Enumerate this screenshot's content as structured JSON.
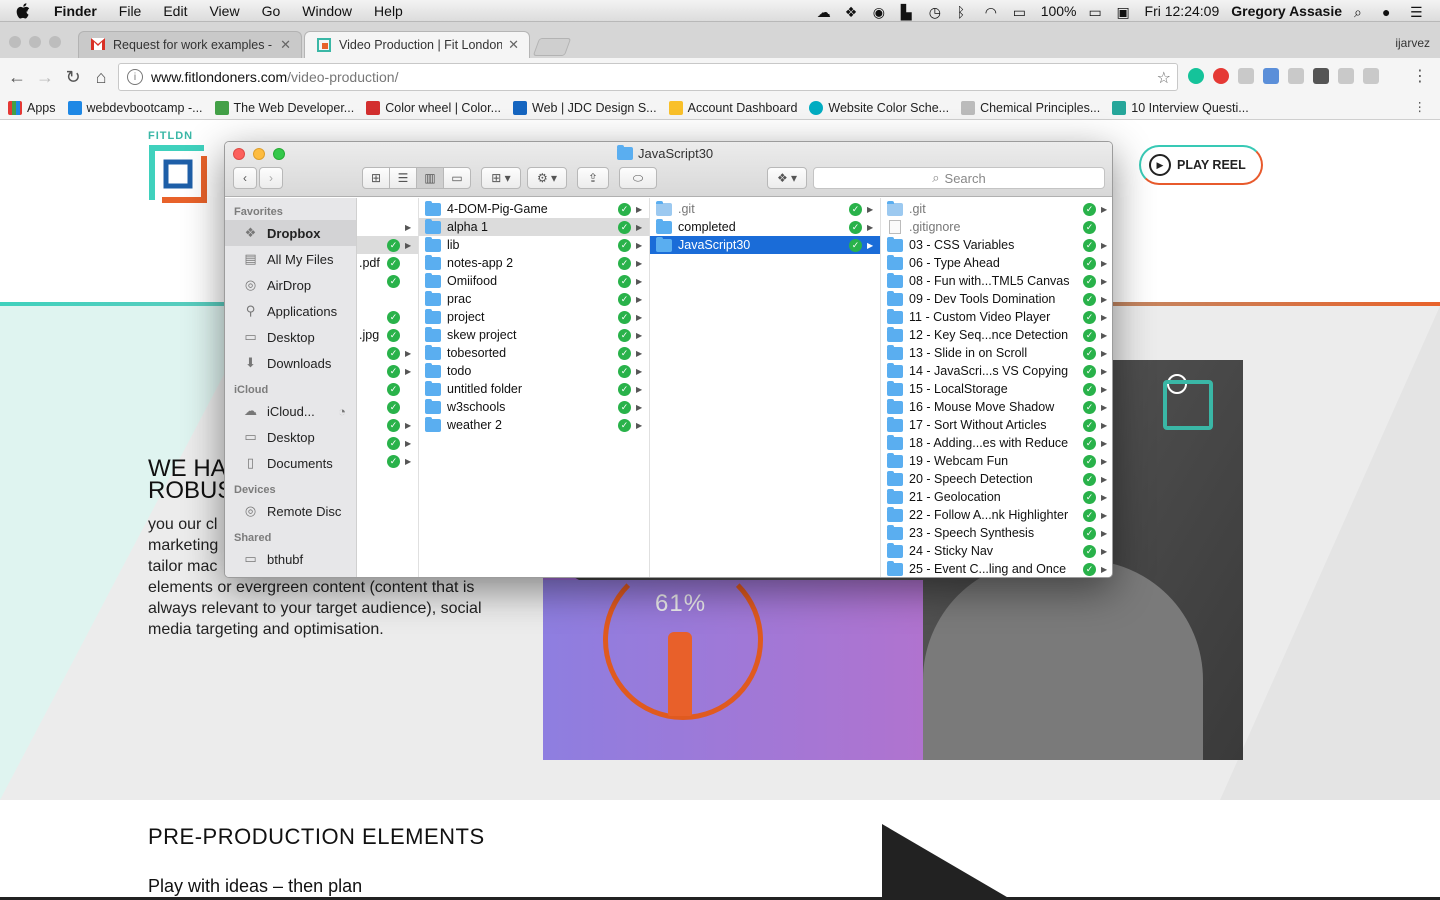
{
  "menubar": {
    "app": "Finder",
    "menus": [
      "File",
      "Edit",
      "View",
      "Go",
      "Window",
      "Help"
    ],
    "battery": "100%",
    "clock": "Fri 12:24:09",
    "user": "Gregory Assasie"
  },
  "browser": {
    "tabs": [
      {
        "title": "Request for work examples - G",
        "active": false
      },
      {
        "title": "Video Production | Fit Londone",
        "active": true
      }
    ],
    "profile": "ijarvez",
    "url_host": "www.fitlondoners.com",
    "url_path": "/video-production/",
    "bookmarks": [
      "Apps",
      "webdevbootcamp -...",
      "The Web Developer...",
      "Color wheel | Color...",
      "Web | JDC Design S...",
      "Account Dashboard",
      "Website Color Sche...",
      "Chemical Principles...",
      "10 Interview Questi..."
    ]
  },
  "page": {
    "logo_text": "FITLDN",
    "play_reel": "PLAY REEL",
    "headline_line1": "WE HA",
    "headline_line2": "ROBUS",
    "body_line1": "you our cl",
    "body_line2": "marketing",
    "body_line3": "tailor mac",
    "body_rest": "elements or evergreen content (content that is always relevant to your target audience), social media targeting and optimisation.",
    "video_percent": "61%",
    "pre_production_title": "PRE-PRODUCTION ELEMENTS",
    "pre_production_sub": "Play with ideas – then plan"
  },
  "finder": {
    "title": "JavaScript30",
    "search_placeholder": "Search",
    "sidebar": {
      "favorites_label": "Favorites",
      "favorites": [
        {
          "label": "Dropbox",
          "icon": "dropbox-icon",
          "selected": true
        },
        {
          "label": "All My Files",
          "icon": "all-files-icon"
        },
        {
          "label": "AirDrop",
          "icon": "airdrop-icon"
        },
        {
          "label": "Applications",
          "icon": "applications-icon"
        },
        {
          "label": "Desktop",
          "icon": "desktop-icon"
        },
        {
          "label": "Downloads",
          "icon": "downloads-icon"
        }
      ],
      "icloud_label": "iCloud",
      "icloud": [
        {
          "label": "iCloud...",
          "icon": "icloud-icon"
        },
        {
          "label": "Desktop",
          "icon": "desktop-icon"
        },
        {
          "label": "Documents",
          "icon": "documents-icon"
        }
      ],
      "devices_label": "Devices",
      "devices": [
        {
          "label": "Remote Disc",
          "icon": "disc-icon"
        }
      ],
      "shared_label": "Shared",
      "shared": [
        {
          "label": "bthubf",
          "icon": "network-icon"
        }
      ]
    },
    "col0": [
      ".pdf",
      ".jpg"
    ],
    "col1": [
      "4-DOM-Pig-Game",
      "alpha 1",
      "lib",
      "notes-app 2",
      "Omiifood",
      "prac",
      "project",
      "skew project",
      "tobesorted",
      "todo",
      "untitled folder",
      "w3schools",
      "weather 2"
    ],
    "col2": [
      ".git",
      "completed",
      "JavaScript30"
    ],
    "col3": [
      ".git",
      ".gitignore",
      "03 - CSS Variables",
      "06 - Type Ahead",
      "08 - Fun with...TML5 Canvas",
      "09 - Dev Tools Domination",
      "11 - Custom Video Player",
      "12 - Key Seq...nce Detection",
      "13 - Slide in on Scroll",
      "14 - JavaScri...s VS Copying",
      "15 - LocalStorage",
      "16 - Mouse Move Shadow",
      "17 - Sort Without Articles",
      "18 - Adding...es with Reduce",
      "19 - Webcam Fun",
      "20 - Speech Detection",
      "21 - Geolocation",
      "22 - Follow A...nk Highlighter",
      "23 - Speech Synthesis",
      "24 - Sticky Nav",
      "25 - Event C...ling and Once"
    ]
  },
  "colors": {
    "selection": "#1a6cd8",
    "sync_check": "#29b24a",
    "brand_teal": "#3fd1bd",
    "brand_orange": "#e8622a"
  }
}
